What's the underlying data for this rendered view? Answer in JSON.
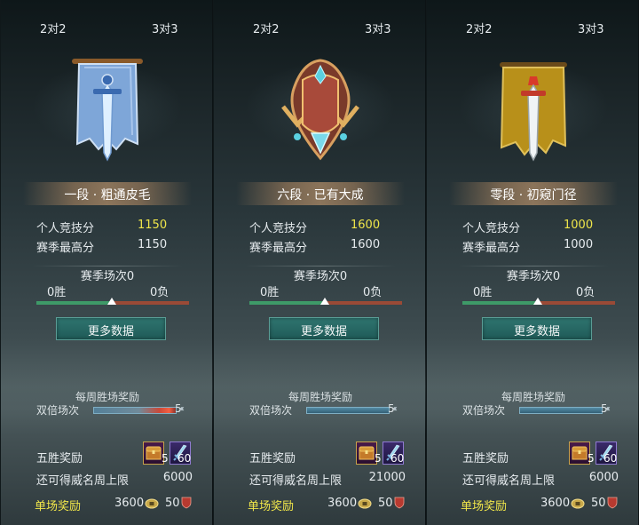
{
  "panels": [
    {
      "tab_left": "2对2",
      "tab_right": "3对3",
      "rank_title": "一段 · 粗通皮毛",
      "emblem": "blue-banner-sword",
      "personal_score_label": "个人竞技分",
      "personal_score": "1150",
      "season_high_label": "赛季最高分",
      "season_high": "1150",
      "season_matches": "赛季场次0",
      "wins": "0胜",
      "losses": "0负",
      "more_btn": "更多数据",
      "weekly_reward": "每周胜场奖励",
      "double_label": "双倍场次",
      "double_count": "5",
      "double_hot": true,
      "five_win_label": "五胜奖励",
      "chest_count": "5",
      "sword_count": "60",
      "cap_label": "还可得威名周上限",
      "cap_value": "6000",
      "single_label": "单场奖励",
      "single_coin": "3600",
      "single_honor": "50"
    },
    {
      "tab_left": "2对2",
      "tab_right": "3对3",
      "rank_title": "六段 · 已有大成",
      "emblem": "bronze-crest",
      "personal_score_label": "个人竞技分",
      "personal_score": "1600",
      "season_high_label": "赛季最高分",
      "season_high": "1600",
      "season_matches": "赛季场次0",
      "wins": "0胜",
      "losses": "0负",
      "more_btn": "更多数据",
      "weekly_reward": "每周胜场奖励",
      "double_label": "双倍场次",
      "double_count": "5",
      "double_hot": false,
      "five_win_label": "五胜奖励",
      "chest_count": "5",
      "sword_count": "60",
      "cap_label": "还可得威名周上限",
      "cap_value": "21000",
      "single_label": "单场奖励",
      "single_coin": "3600",
      "single_honor": "50"
    },
    {
      "tab_left": "2对2",
      "tab_right": "3对3",
      "rank_title": "零段 · 初窥门径",
      "emblem": "gold-banner-sword",
      "personal_score_label": "个人竞技分",
      "personal_score": "1000",
      "season_high_label": "赛季最高分",
      "season_high": "1000",
      "season_matches": "赛季场次0",
      "wins": "0胜",
      "losses": "0负",
      "more_btn": "更多数据",
      "weekly_reward": "每周胜场奖励",
      "double_label": "双倍场次",
      "double_count": "5",
      "double_hot": false,
      "five_win_label": "五胜奖励",
      "chest_count": "5",
      "sword_count": "60",
      "cap_label": "还可得威名周上限",
      "cap_value": "6000",
      "single_label": "单场奖励",
      "single_coin": "3600",
      "single_honor": "50"
    }
  ],
  "colors": {
    "score_highlight": "#f0e64a",
    "win_bar": "#3e9a68",
    "loss_bar": "#9a4a36",
    "button": "#2a6b67"
  }
}
